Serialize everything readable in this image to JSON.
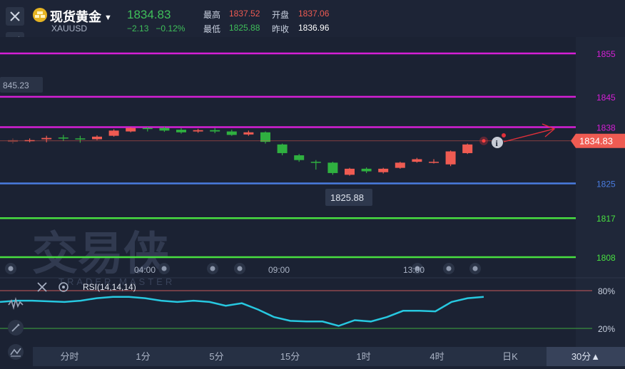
{
  "header": {
    "title": "现货黄金",
    "symbol": "XAUUSD",
    "price": "1834.83",
    "change": "−2.13",
    "change_pct": "−0.12%",
    "high_label": "最高",
    "high_value": "1837.52",
    "open_label": "开盘",
    "open_value": "1837.06",
    "low_label": "最低",
    "low_value": "1825.88",
    "prev_close_label": "昨收",
    "prev_close_value": "1836.96"
  },
  "price_lines": [
    {
      "label": "1855",
      "value": 1855,
      "color": "#d61fd6"
    },
    {
      "label": "1845",
      "value": 1845,
      "color": "#d61fd6"
    },
    {
      "label": "1838",
      "value": 1838,
      "color": "#d61fd6"
    },
    {
      "label": "1825",
      "value": 1825,
      "color": "#4a7ce0"
    },
    {
      "label": "1817",
      "value": 1817,
      "color": "#48e040"
    },
    {
      "label": "1808",
      "value": 1808,
      "color": "#48e040"
    }
  ],
  "left_price_tag": "845.23",
  "current_price_tag": "1834.83",
  "low_tooltip": "1825.88",
  "time_labels": [
    "04:00",
    "09:00",
    "13:00"
  ],
  "watermark": {
    "cn": "交易侠",
    "en": "TRADER MASTER"
  },
  "rsi": {
    "label": "RSI(14,14,14)",
    "upper_label": "80%",
    "lower_label": "20%",
    "values": [
      62,
      64,
      64,
      63,
      62,
      64,
      68,
      70,
      70,
      68,
      64,
      62,
      64,
      62,
      56,
      60,
      50,
      38,
      32,
      31,
      31,
      24,
      33,
      31,
      38,
      48,
      48,
      47,
      62,
      68,
      70
    ],
    "line_color": "#27c8e0"
  },
  "chart_data": {
    "type": "candlestick",
    "ylim": [
      1804,
      1860
    ],
    "candles": [
      {
        "o": 1835.0,
        "c": 1834.6,
        "h": 1835.4,
        "l": 1834.2
      },
      {
        "o": 1834.8,
        "c": 1835.0,
        "h": 1835.4,
        "l": 1834.5
      },
      {
        "o": 1835.2,
        "c": 1835.5,
        "h": 1836.0,
        "l": 1834.5
      },
      {
        "o": 1835.6,
        "c": 1835.4,
        "h": 1836.2,
        "l": 1834.8
      },
      {
        "o": 1835.4,
        "c": 1835.2,
        "h": 1836.0,
        "l": 1834.4
      },
      {
        "o": 1835.2,
        "c": 1835.8,
        "h": 1836.1,
        "l": 1835.0
      },
      {
        "o": 1836.0,
        "c": 1837.2,
        "h": 1837.5,
        "l": 1835.8
      },
      {
        "o": 1837.0,
        "c": 1837.8,
        "h": 1838.0,
        "l": 1836.8
      },
      {
        "o": 1837.8,
        "c": 1837.6,
        "h": 1838.0,
        "l": 1837.0
      },
      {
        "o": 1837.8,
        "c": 1837.2,
        "h": 1838.1,
        "l": 1836.9
      },
      {
        "o": 1837.4,
        "c": 1836.8,
        "h": 1837.8,
        "l": 1836.5
      },
      {
        "o": 1837.0,
        "c": 1837.3,
        "h": 1837.6,
        "l": 1836.7
      },
      {
        "o": 1837.3,
        "c": 1837.0,
        "h": 1837.8,
        "l": 1836.6
      },
      {
        "o": 1837.0,
        "c": 1836.2,
        "h": 1837.4,
        "l": 1836.0
      },
      {
        "o": 1836.3,
        "c": 1836.8,
        "h": 1837.2,
        "l": 1836.0
      },
      {
        "o": 1836.8,
        "c": 1834.6,
        "h": 1837.0,
        "l": 1834.2
      },
      {
        "o": 1834.0,
        "c": 1832.0,
        "h": 1834.2,
        "l": 1831.5
      },
      {
        "o": 1831.5,
        "c": 1830.4,
        "h": 1831.8,
        "l": 1830.0
      },
      {
        "o": 1830.0,
        "c": 1829.8,
        "h": 1830.4,
        "l": 1828.2
      },
      {
        "o": 1829.8,
        "c": 1827.4,
        "h": 1830.0,
        "l": 1827.0
      },
      {
        "o": 1827.0,
        "c": 1828.4,
        "h": 1828.6,
        "l": 1826.8
      },
      {
        "o": 1828.4,
        "c": 1827.8,
        "h": 1828.7,
        "l": 1827.4
      },
      {
        "o": 1827.6,
        "c": 1828.4,
        "h": 1828.6,
        "l": 1827.3
      },
      {
        "o": 1828.6,
        "c": 1829.8,
        "h": 1830.0,
        "l": 1828.4
      },
      {
        "o": 1830.0,
        "c": 1830.6,
        "h": 1830.9,
        "l": 1829.8
      },
      {
        "o": 1830.0,
        "c": 1830.0,
        "h": 1830.6,
        "l": 1829.6
      },
      {
        "o": 1829.4,
        "c": 1832.4,
        "h": 1832.6,
        "l": 1829.0
      },
      {
        "o": 1832.0,
        "c": 1834.0,
        "h": 1834.2,
        "l": 1831.8
      }
    ]
  },
  "tabs": [
    "分时",
    "1分",
    "5分",
    "15分",
    "1时",
    "4时",
    "日K",
    "30分▲"
  ],
  "colors": {
    "up": "#ef5b52",
    "down": "#2fb040",
    "background": "#1b2233"
  }
}
